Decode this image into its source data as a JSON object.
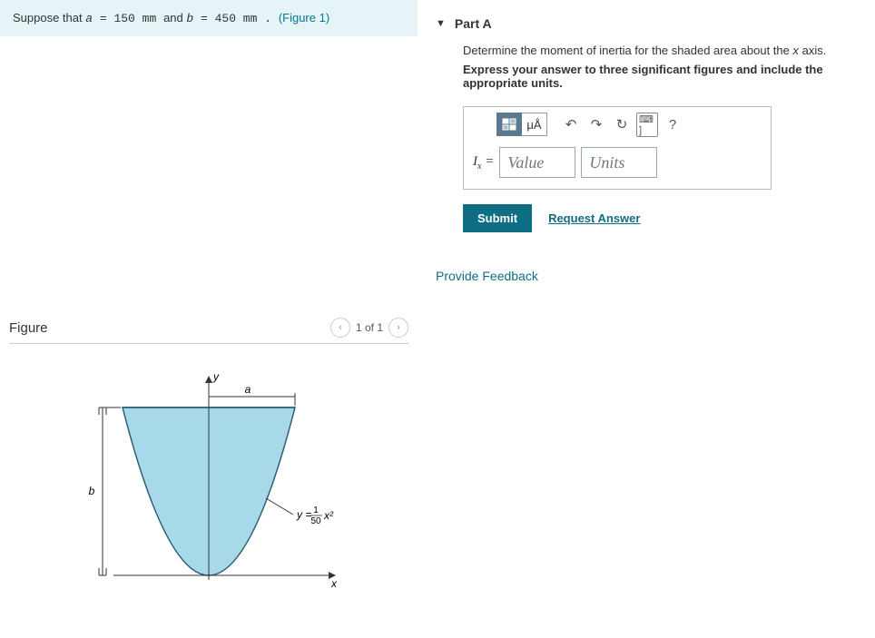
{
  "problem": {
    "prefix": "Suppose that ",
    "a_var": "a",
    "a_val": " = 150  mm ",
    "mid": "and ",
    "b_var": "b",
    "b_val": " = 450  mm . ",
    "fig_ref": "(Figure 1)"
  },
  "figure": {
    "title": "Figure",
    "counter": "1 of 1",
    "labels": {
      "y": "y",
      "x": "x",
      "a": "a",
      "b": "b"
    },
    "equation_pre": "y = ",
    "equation_num": "1",
    "equation_den": "50",
    "equation_post": " x²"
  },
  "partA": {
    "label": "Part A",
    "instruction_html": "Determine the moment of inertia for the shaded area about the x axis.",
    "instruction_bold": "Express your answer to three significant figures and include the appropriate units.",
    "toolbar": {
      "templates": "▭",
      "muA": "μÅ",
      "undo": "↶",
      "redo": "↷",
      "reset": "↻",
      "keyboard": "⌨ ]",
      "help": "?"
    },
    "lhs_sym": "I",
    "lhs_sub": "x",
    "equals": " = ",
    "value_placeholder": "Value",
    "units_placeholder": "Units",
    "submit": "Submit",
    "request": "Request Answer"
  },
  "feedback": "Provide Feedback"
}
